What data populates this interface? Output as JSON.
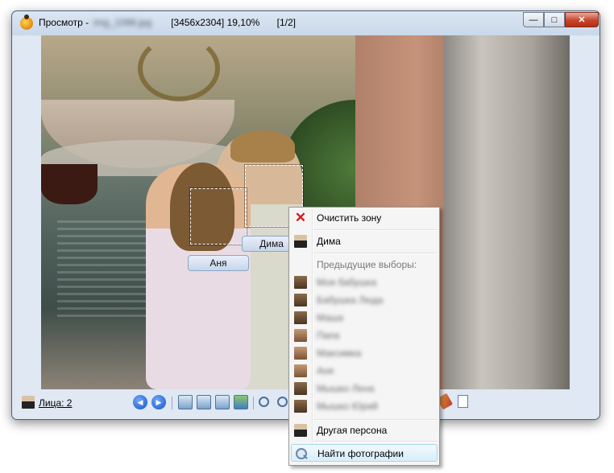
{
  "window": {
    "title": "Просмотр -",
    "title_obscured": "img_1098.jpg",
    "dimensions": "[3456x2304]",
    "zoom": "19,10%",
    "position": "[1/2]",
    "controls": {
      "minimize": "—",
      "maximize": "□",
      "close": "✕"
    }
  },
  "faces": [
    {
      "name": "Аня"
    },
    {
      "name": "Дима"
    }
  ],
  "statusbar": {
    "faces_label": "Лица: 2",
    "tools": [
      "prev-icon",
      "next-icon",
      "fit-icon",
      "actual-size-icon",
      "slideshow-icon",
      "image-icon",
      "zoom-out-icon",
      "zoom-in-icon",
      "edit-icon",
      "document-icon"
    ]
  },
  "context_menu": {
    "clear_zone": "Очистить зону",
    "person_current": "Дима",
    "previous_header": "Предыдущие выборы:",
    "previous_items": [
      "Моя бабушка",
      "Бабушка Люда",
      "Маша",
      "Папа",
      "Максимка",
      "Аня",
      "Мышко Лена",
      "Мышко Юрий"
    ],
    "other_person": "Другая персона",
    "find_photos": "Найти фотографии"
  }
}
